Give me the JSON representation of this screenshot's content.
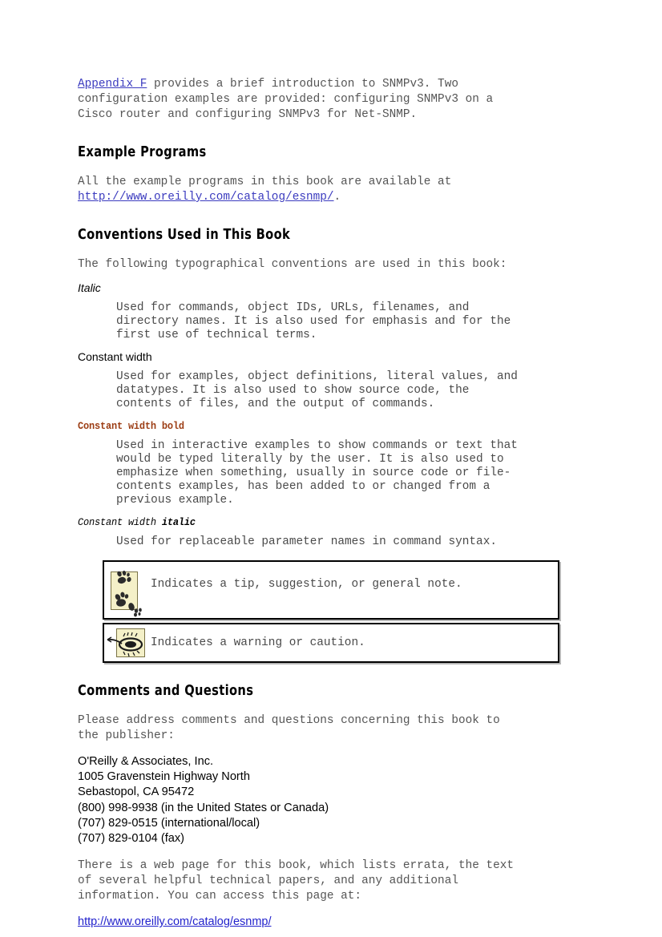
{
  "document": {
    "intro": {
      "link_label": "Appendix F",
      "text_after_link": " provides a brief introduction to SNMPv3. Two\nconfiguration examples are provided: configuring SNMPv3 on a\nCisco router and configuring SNMPv3 for Net-SNMP."
    },
    "sections": [
      {
        "id": "example-programs",
        "heading": "Example Programs",
        "paragraph_before_link": "All the example programs in this book are available at\n",
        "link_label": "http://www.oreilly.com/catalog/esnmp/",
        "paragraph_after_link": "."
      },
      {
        "id": "conventions-used-in-this-book",
        "heading": "Conventions Used in This Book",
        "lead": "The following typographical conventions are used in this book:"
      },
      {
        "id": "comments-and-questions",
        "heading": "Comments and Questions",
        "lead": "Please address comments and questions concerning this book to\nthe publisher:"
      }
    ],
    "conventions": [
      {
        "term": "Italic",
        "term_style": "sans-italic",
        "definition": "Used for commands, object IDs, URLs, filenames, and\ndirectory names. It is also used for emphasis and for the\nfirst use of technical terms."
      },
      {
        "term": "Constant width",
        "term_style": "sans-regular",
        "definition": "Used for examples, object definitions, literal values, and\ndatatypes. It is also used to show source code, the\ncontents of files, and the output of commands."
      },
      {
        "term": "Constant width bold",
        "term_style": "mono-bold-rust",
        "definition": "Used in interactive examples to show commands or text that\nwould be typed literally by the user. It is also used to\nemphasize when something, usually in source code or file-\ncontents examples, has been added to or changed from a\nprevious example."
      },
      {
        "term_part1": "Constant width ",
        "term_part2": "italic",
        "term_style": "mono-italic",
        "definition": "Used for replaceable parameter names in command syntax."
      }
    ],
    "notes": [
      {
        "id": "tip",
        "icon": "paw-prints-icon",
        "text": "Indicates a tip, suggestion, or general note."
      },
      {
        "id": "warning",
        "icon": "scorpion-icon",
        "text": "Indicates a warning or caution."
      }
    ],
    "address": {
      "lines": "O'Reilly & Associates, Inc.\n1005 Gravenstein Highway North\nSebastopol, CA 95472\n(800) 998-9938 (in the United States or Canada)\n(707) 829-0515 (international/local)\n(707) 829-0104 (fax)"
    },
    "closing": {
      "paragraph": "There is a web page for this book, which lists errata, the text\nof several helpful technical papers, and any additional\ninformation. You can access this page at:",
      "link_label": "http://www.oreilly.com/catalog/esnmp/"
    },
    "colors": {
      "link_mono": "#3b3bbf",
      "link_sans": "#2222cc",
      "constant_width_bold": "#9c3d14",
      "body_text": "#4a4a4a",
      "heading": "#000000",
      "icon_fill": "#f4f0c8",
      "box_border": "#000000"
    }
  }
}
